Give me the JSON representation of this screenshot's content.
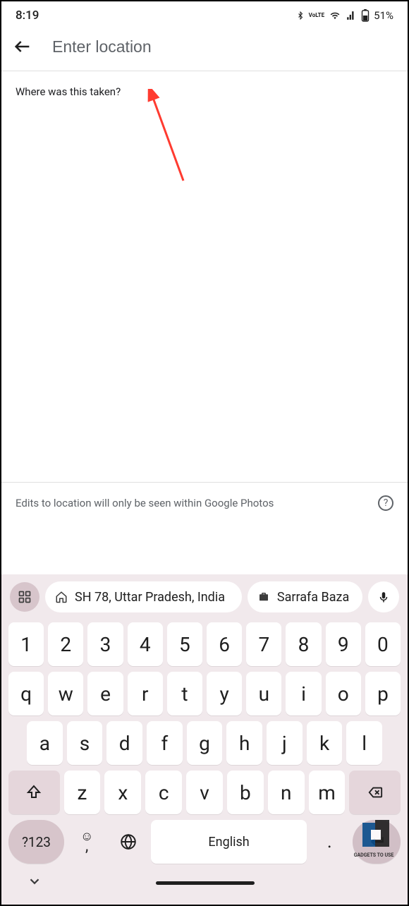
{
  "status": {
    "time": "8:19",
    "battery": "51%"
  },
  "appbar": {
    "placeholder": "Enter location"
  },
  "prompt": "Where was this taken?",
  "disclaimer": "Edits to location will only be seen within Google Photos",
  "suggestions": {
    "s1": "SH 78, Uttar Pradesh, India",
    "s2": "Sarrafa Baza"
  },
  "keyboard": {
    "row1": [
      "1",
      "2",
      "3",
      "4",
      "5",
      "6",
      "7",
      "8",
      "9",
      "0"
    ],
    "row2": [
      "q",
      "w",
      "e",
      "r",
      "t",
      "y",
      "u",
      "i",
      "o",
      "p"
    ],
    "row3": [
      "a",
      "s",
      "d",
      "f",
      "g",
      "h",
      "j",
      "k",
      "l"
    ],
    "row4": [
      "z",
      "x",
      "c",
      "v",
      "b",
      "n",
      "m"
    ],
    "space": "English",
    "sym": "?123",
    "comma": ",",
    "period": "."
  },
  "watermark": "GADGETS TO USE"
}
